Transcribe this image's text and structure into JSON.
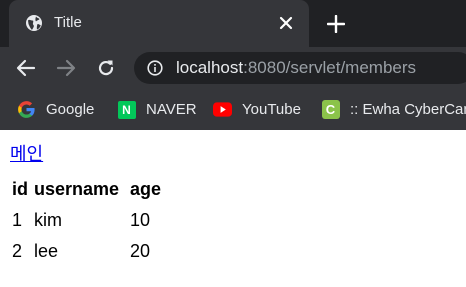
{
  "browser": {
    "tab": {
      "title": "Title",
      "favicon": "globe-icon"
    },
    "url": {
      "host": "localhost",
      "rest": ":8080/servlet/members"
    },
    "bookmarks": [
      {
        "label": "Google",
        "icon": "google-icon"
      },
      {
        "label": "NAVER",
        "icon": "naver-icon",
        "icon_letter": "N",
        "color": "#03c75a"
      },
      {
        "label": "YouTube",
        "icon": "youtube-icon",
        "color": "#ff0000"
      },
      {
        "label": ":: Ewha CyberCam",
        "icon": "ewha-icon",
        "icon_letter": "C",
        "color": "#8bc34a"
      }
    ]
  },
  "page": {
    "home_link": "메인",
    "table": {
      "headers": [
        "id",
        "username",
        "age"
      ],
      "rows": [
        [
          "1",
          "kim",
          "10"
        ],
        [
          "2",
          "lee",
          "20"
        ]
      ]
    }
  },
  "colors": {
    "chrome_dark": "#202124",
    "chrome_tab": "#35363a",
    "link": "#0000ee"
  }
}
